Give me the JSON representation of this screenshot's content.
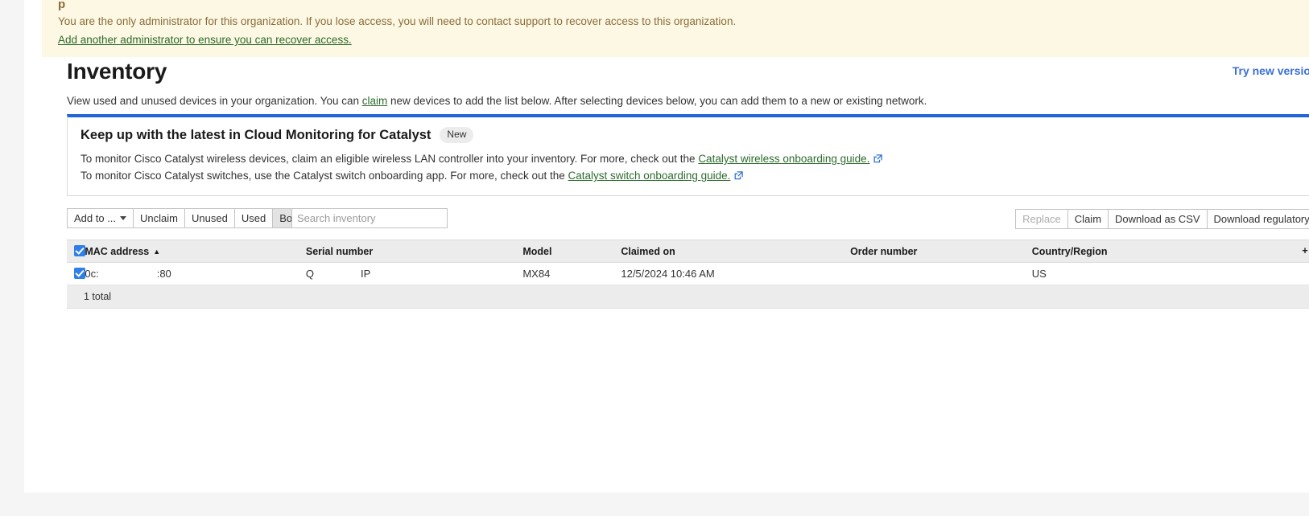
{
  "admin_banner": {
    "heading_partial": "p",
    "text": "You are the only administrator for this organization. If you lose access, you will need to contact support to recover access to this organization.",
    "link": "Add another administrator to ensure you can recover access."
  },
  "header": {
    "title": "Inventory",
    "try_new_version": "Try new versio",
    "subtitle_part1": "View used and unused devices in your organization. You can ",
    "subtitle_link": "claim",
    "subtitle_part2": " new devices to add the list below. After selecting devices below, you can add them to a new or existing network."
  },
  "catalyst_callout": {
    "title": "Keep up with the latest in Cloud Monitoring for Catalyst",
    "badge": "New",
    "line1_text": "To monitor Cisco Catalyst wireless devices, claim an eligible wireless LAN controller into your inventory. For more, check out the ",
    "line1_link": "Catalyst wireless onboarding guide.",
    "line2_text": "To monitor Cisco Catalyst switches, use the Catalyst switch onboarding app. For more, check out the ",
    "line2_link": "Catalyst switch onboarding guide.",
    "accent_color": "#1f64d8",
    "link_color": "#2d6b2d",
    "ext_icon_color": "#2f6fd0"
  },
  "toolbar": {
    "add_to": "Add to ...",
    "unclaim": "Unclaim",
    "unused": "Unused",
    "used": "Used",
    "both": "Both",
    "active_filter": "Both",
    "search_placeholder": "Search inventory",
    "search_value": "",
    "replace": "Replace",
    "claim": "Claim",
    "download_csv": "Download as CSV",
    "download_regulatory": "Download regulatory file"
  },
  "table": {
    "columns": [
      "MAC address",
      "Serial number",
      "Model",
      "Claimed on",
      "Order number",
      "Country/Region"
    ],
    "sort_column": "MAC address",
    "sort_direction": "▲",
    "add_column_label": "+",
    "rows": [
      {
        "selected": true,
        "mac_prefix": "0c:",
        "mac_suffix": ":80",
        "serial_prefix": "Q",
        "serial_suffix": "IP",
        "model": "MX84",
        "claimed_on": "12/5/2024 10:46 AM",
        "order_number": "",
        "country": "US"
      }
    ],
    "total": "1 total"
  }
}
